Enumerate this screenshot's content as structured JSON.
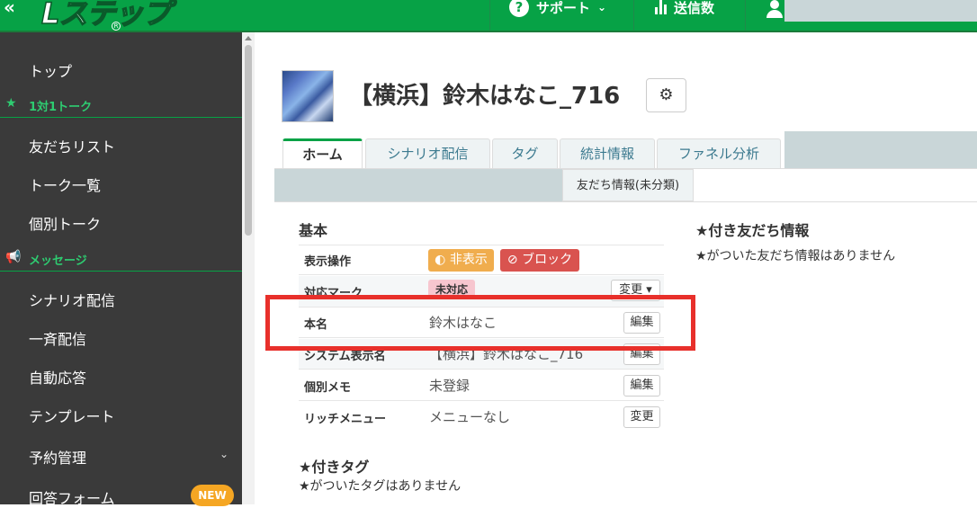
{
  "header": {
    "collapse_glyph": "«",
    "logo_text": "Lステップ",
    "logo_reg": "R",
    "support_label": "サポート",
    "support_chevron": "⌄",
    "send_count_label": "送信数",
    "colors": {
      "brand": "#07a246",
      "sidebar": "#3a3a3a",
      "accent_red": "#e8302b"
    }
  },
  "sidebar": {
    "items": [
      {
        "type": "item",
        "label": "トップ"
      },
      {
        "type": "category",
        "label": "1対1トーク",
        "icon": "star-icon"
      },
      {
        "type": "item",
        "label": "友だちリスト"
      },
      {
        "type": "item",
        "label": "トーク一覧"
      },
      {
        "type": "item",
        "label": "個別トーク"
      },
      {
        "type": "category",
        "label": "メッセージ",
        "icon": "megaphone-icon"
      },
      {
        "type": "item",
        "label": "シナリオ配信"
      },
      {
        "type": "item",
        "label": "一斉配信"
      },
      {
        "type": "item",
        "label": "自動応答"
      },
      {
        "type": "item",
        "label": "テンプレート"
      },
      {
        "type": "item",
        "label": "予約管理"
      },
      {
        "type": "item",
        "label": "回答フォーム"
      }
    ],
    "new_badge": "NEW"
  },
  "profile": {
    "name": "【横浜】鈴木はなこ_716",
    "settings_glyph": "⚙"
  },
  "tabs": [
    {
      "label": "ホーム",
      "active": true
    },
    {
      "label": "シナリオ配信",
      "active": false
    },
    {
      "label": "タグ",
      "active": false
    },
    {
      "label": "統計情報",
      "active": false
    },
    {
      "label": "ファネル分析",
      "active": false
    }
  ],
  "subtab": {
    "label": "友だち情報(未分類)"
  },
  "basic": {
    "title": "基本",
    "rows": [
      {
        "label": "表示操作",
        "hide_label": "非表示",
        "block_label": "ブロック"
      },
      {
        "label": "対応マーク",
        "mark": "未対応",
        "change_label": "変更 ▾"
      },
      {
        "label": "本名",
        "value": "鈴木はなこ",
        "button": "編集"
      },
      {
        "label": "システム表示名",
        "value": "【横浜】鈴木はなこ_716",
        "button": "編集"
      },
      {
        "label": "個別メモ",
        "value": "未登録",
        "button": "編集"
      },
      {
        "label": "リッチメニュー",
        "value": "メニューなし",
        "button": "変更"
      }
    ]
  },
  "starred_friend_info": {
    "title": "★付き友だち情報",
    "empty": "★がついた友だち情報はありません"
  },
  "starred_tags": {
    "title": "★付きタグ",
    "empty": "★がついたタグはありません"
  }
}
